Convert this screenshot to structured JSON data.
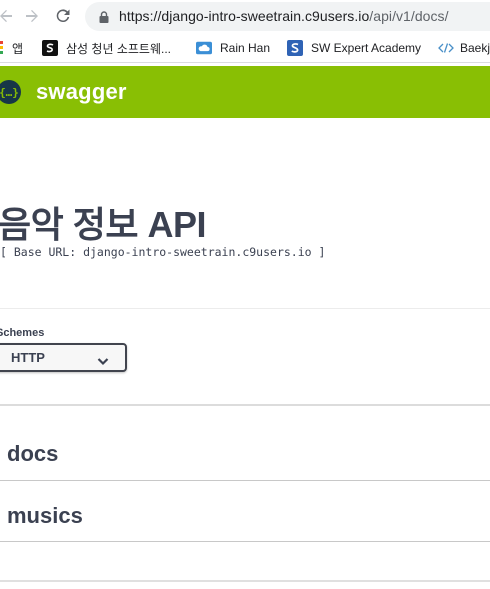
{
  "browser": {
    "url_main": "https://django-intro-sweetrain.c9users.io",
    "url_path": "/api/v1/docs/"
  },
  "bookmarks": [
    {
      "label": "앱",
      "icon": "apps-grid-icon"
    },
    {
      "label": "삼성 청년 소프트웨...",
      "icon": "samsung-academy-icon"
    },
    {
      "label": "Rain Han",
      "icon": "cloud-icon"
    },
    {
      "label": "SW Expert Academy",
      "icon": "swea-icon"
    },
    {
      "label": "Baekj",
      "icon": "code-brackets-icon"
    }
  ],
  "swagger": {
    "brand": "swagger",
    "logo_glyph": "{…}"
  },
  "api": {
    "title": "음악 정보 API",
    "base_url": "[ Base URL: django-intro-sweetrain.c9users.io ]"
  },
  "schemes": {
    "label": "Schemes",
    "selected": "HTTP"
  },
  "tags": [
    {
      "name": "docs"
    },
    {
      "name": "musics"
    }
  ],
  "colors": {
    "topbar": "#89bf04",
    "text": "#3b4151"
  }
}
